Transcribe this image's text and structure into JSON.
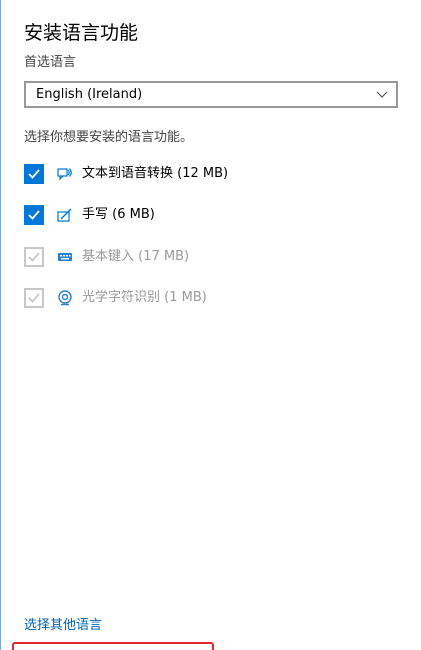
{
  "panel": {
    "title": "安装语言功能",
    "preferred_language_label": "首选语言",
    "preferred_language_value": "English (Ireland)",
    "instruction": "选择你想要安装的语言功能。",
    "features": [
      {
        "label": "文本到语音转换 (12 MB)",
        "checked": true,
        "enabled": true,
        "icon": "speech-icon"
      },
      {
        "label": "手写 (6 MB)",
        "checked": true,
        "enabled": true,
        "icon": "handwriting-icon"
      },
      {
        "label": "基本键入 (17 MB)",
        "checked": true,
        "enabled": false,
        "icon": "keyboard-icon"
      },
      {
        "label": "光学字符识别 (1 MB)",
        "checked": true,
        "enabled": false,
        "icon": "ocr-icon"
      }
    ],
    "other_languages_link": "选择其他语言"
  },
  "colors": {
    "accent": "#0078d7",
    "link": "#0063b1",
    "highlight_outline": "#e0282e",
    "disabled": "#c8c8c8"
  }
}
